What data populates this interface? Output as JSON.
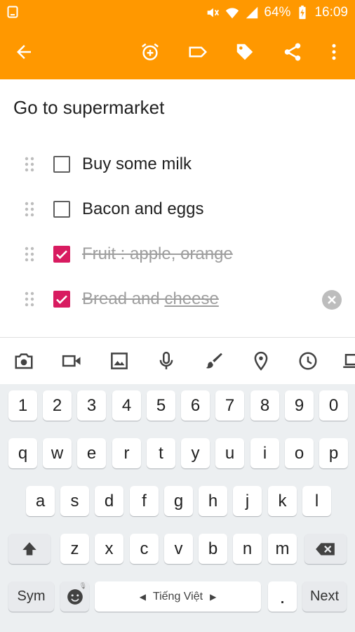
{
  "status_bar": {
    "battery": "64%",
    "time": "16:09",
    "icons": [
      "notification-icon",
      "mute-icon",
      "wifi-icon",
      "signal-icon",
      "battery-charging-icon"
    ]
  },
  "toolbar": {
    "background": "#ff9800",
    "buttons": [
      "back-arrow-icon",
      "add-alarm-icon",
      "label-icon",
      "tag-icon",
      "share-icon",
      "more-vert-icon"
    ]
  },
  "note": {
    "title": "Go to supermarket",
    "items": [
      {
        "text": "Buy some milk",
        "checked": false
      },
      {
        "text": "Bacon and eggs",
        "checked": false
      },
      {
        "text": "Fruit : apple, orange",
        "checked": true
      },
      {
        "text_before": "Bread and ",
        "text_underlined": "cheese",
        "checked": true
      }
    ],
    "check_color": "#d81b60"
  },
  "attachments": [
    "camera-icon",
    "video-icon",
    "image-icon",
    "mic-icon",
    "brush-icon",
    "location-icon",
    "clock-icon",
    "laptop-icon"
  ],
  "keyboard": {
    "row_numbers": [
      "1",
      "2",
      "3",
      "4",
      "5",
      "6",
      "7",
      "8",
      "9",
      "0"
    ],
    "row_1": [
      "q",
      "w",
      "e",
      "r",
      "t",
      "y",
      "u",
      "i",
      "o",
      "p"
    ],
    "row_2": [
      "a",
      "s",
      "d",
      "f",
      "g",
      "h",
      "j",
      "k",
      "l"
    ],
    "row_3": [
      "z",
      "x",
      "c",
      "v",
      "b",
      "n",
      "m"
    ],
    "sym_label": "Sym",
    "space_label": "Tiếng Việt",
    "period_label": ".",
    "next_label": "Next"
  }
}
